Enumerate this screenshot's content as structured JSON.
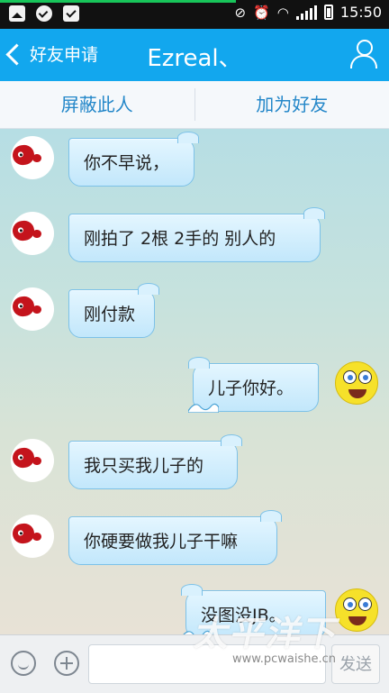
{
  "status_bar": {
    "time": "15:50"
  },
  "header": {
    "back_label": "好友申请",
    "title": "Ezreal、"
  },
  "actions": {
    "block": "屏蔽此人",
    "add_friend": "加为好友"
  },
  "messages": [
    {
      "side": "left",
      "text": "你不早说，"
    },
    {
      "side": "left",
      "text": "刚拍了 2根 2手的 别人的"
    },
    {
      "side": "left",
      "text": "刚付款"
    },
    {
      "side": "right",
      "text": "儿子你好。"
    },
    {
      "side": "left",
      "text": "我只买我儿子的"
    },
    {
      "side": "left",
      "text": "你硬要做我儿子干嘛"
    },
    {
      "side": "right",
      "text": "没图没JB。"
    }
  ],
  "input_bar": {
    "send_label": "发送"
  },
  "watermark": {
    "text": "太平洋下",
    "url": "www.pcwaishe.cn"
  }
}
